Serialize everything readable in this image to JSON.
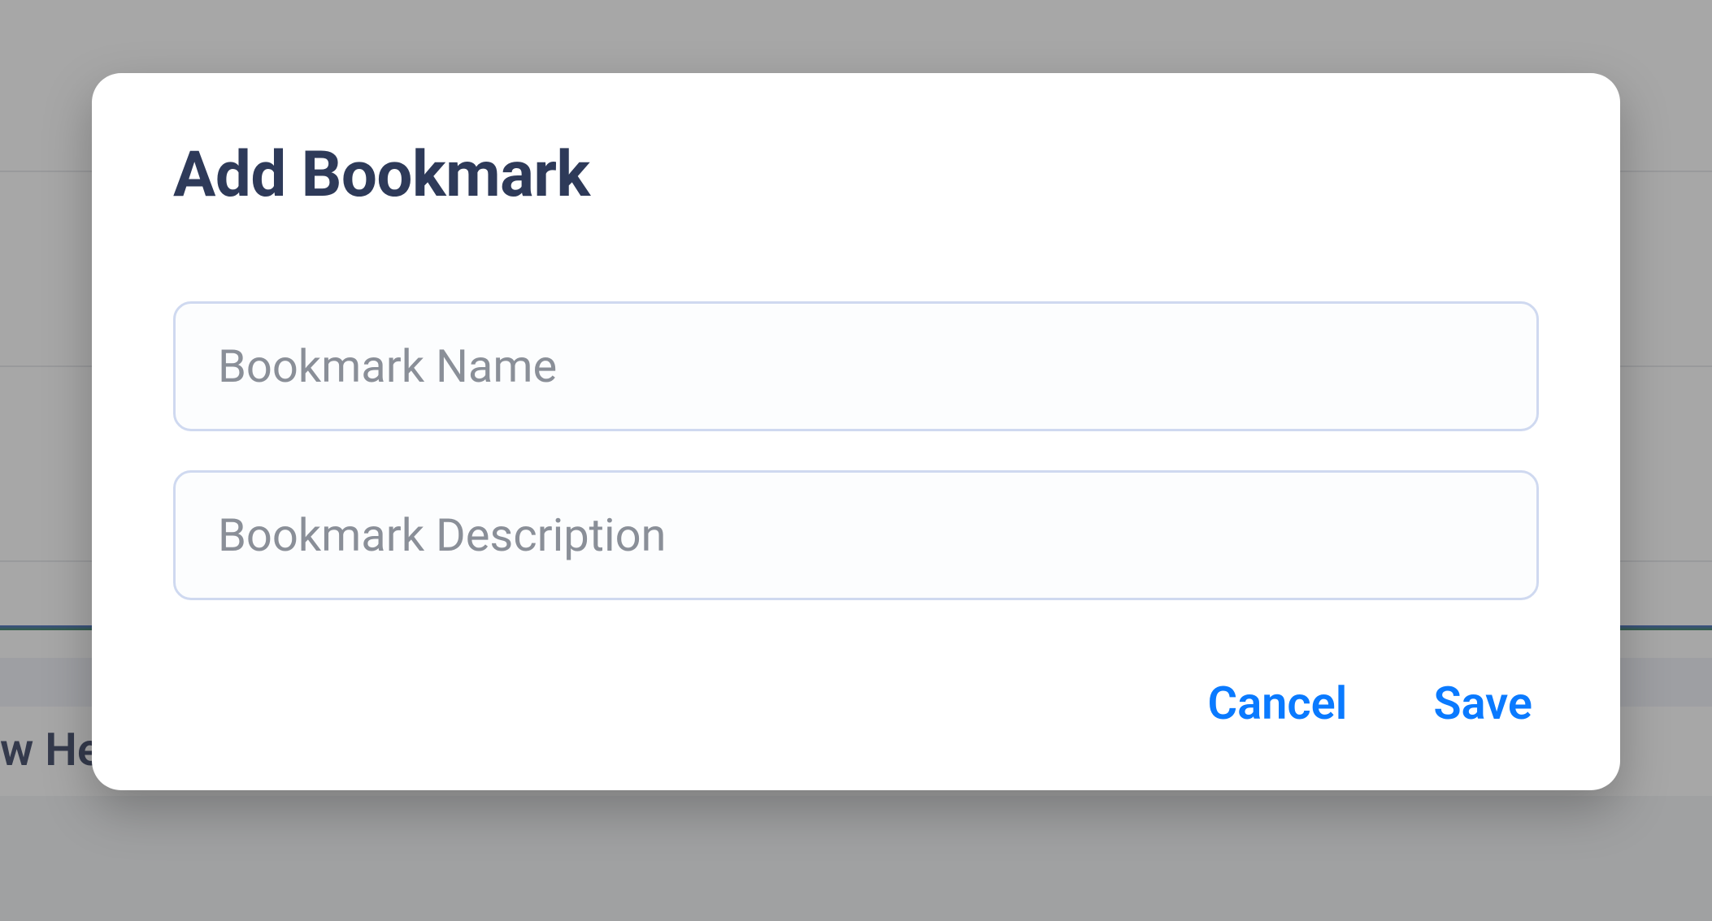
{
  "background": {
    "partial_text": "w He"
  },
  "modal": {
    "title": "Add Bookmark",
    "name_input": {
      "placeholder": "Bookmark Name",
      "value": ""
    },
    "description_input": {
      "placeholder": "Bookmark Description",
      "value": ""
    },
    "cancel_label": "Cancel",
    "save_label": "Save"
  }
}
